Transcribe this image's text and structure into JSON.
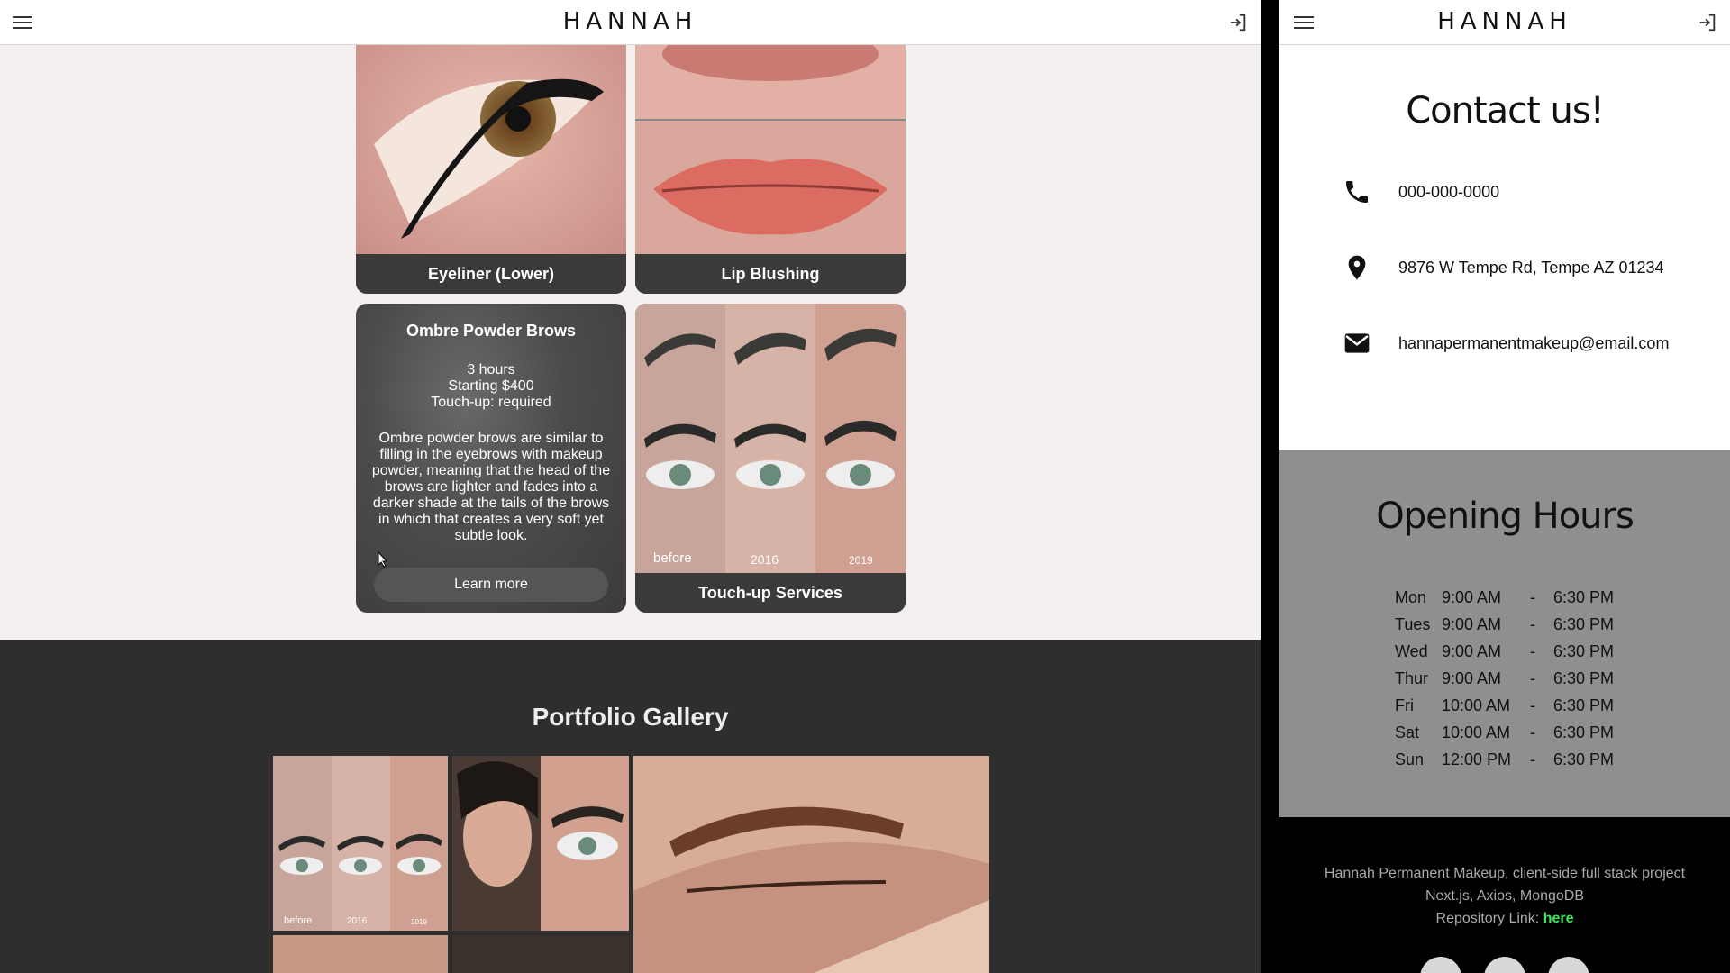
{
  "brand": "HANNAH",
  "left": {
    "cards": [
      {
        "label": "Eyeliner (Lower)"
      },
      {
        "label": "Lip Blushing"
      },
      {
        "title": "Ombre Powder Brows",
        "duration": "3 hours",
        "price": "Starting $400",
        "touchup": "Touch-up: required",
        "description": "Ombre powder brows are similar to filling in the eyebrows with makeup powder, meaning that the head of the brows are lighter and fades into a darker shade at the tails of the brows in which that creates a very soft yet subtle look.",
        "button": "Learn more"
      },
      {
        "label": "Touch-up Services",
        "photo_labels": [
          "before",
          "2016",
          "2019"
        ]
      }
    ],
    "gallery": {
      "title": "Portfolio Gallery",
      "photo_labels": [
        "before",
        "2016",
        "2019"
      ]
    }
  },
  "right": {
    "contact": {
      "title": "Contact us!",
      "phone": "000-000-0000",
      "address": "9876 W Tempe Rd, Tempe AZ 01234",
      "email": "hannapermanentmakeup@email.com"
    },
    "hours": {
      "title": "Opening Hours",
      "rows": [
        {
          "day": "Mon",
          "open": "9:00 AM",
          "close": "6:30 PM"
        },
        {
          "day": "Tues",
          "open": "9:00 AM",
          "close": "6:30 PM"
        },
        {
          "day": "Wed",
          "open": "9:00 AM",
          "close": "6:30 PM"
        },
        {
          "day": "Thur",
          "open": "9:00 AM",
          "close": "6:30 PM"
        },
        {
          "day": "Fri",
          "open": "10:00 AM",
          "close": "6:30 PM"
        },
        {
          "day": "Sat",
          "open": "10:00 AM",
          "close": "6:30 PM"
        },
        {
          "day": "Sun",
          "open": "12:00 PM",
          "close": "6:30 PM"
        }
      ],
      "sep": "-"
    },
    "footer": {
      "line1": "Hannah Permanent Makeup, client-side full stack project",
      "line2": "Next.js, Axios, MongoDB",
      "repo_label": "Repository Link:",
      "repo_link": "here"
    }
  }
}
